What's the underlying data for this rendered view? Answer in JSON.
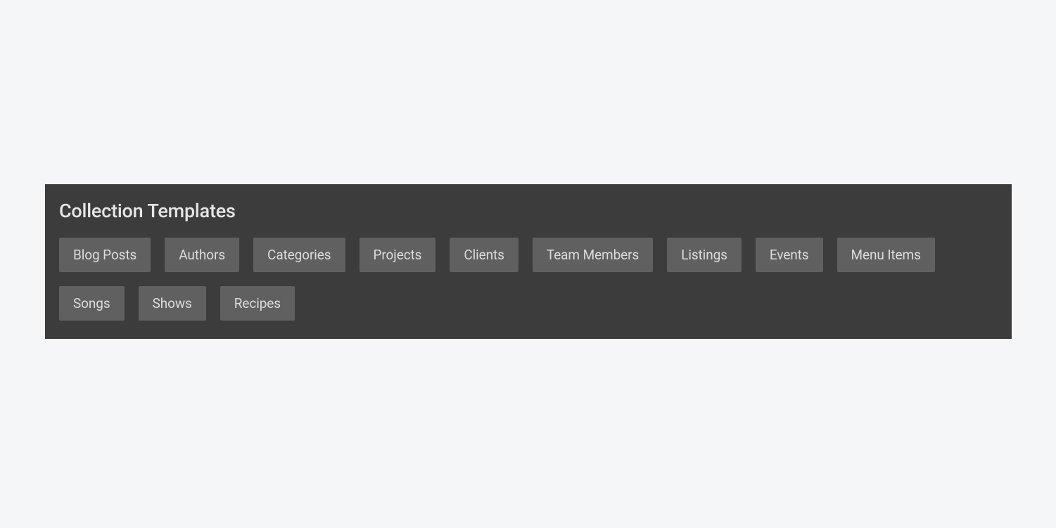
{
  "panel": {
    "title": "Collection Templates",
    "templates": [
      "Blog Posts",
      "Authors",
      "Categories",
      "Projects",
      "Clients",
      "Team Members",
      "Listings",
      "Events",
      "Menu Items",
      "Songs",
      "Shows",
      "Recipes"
    ]
  }
}
